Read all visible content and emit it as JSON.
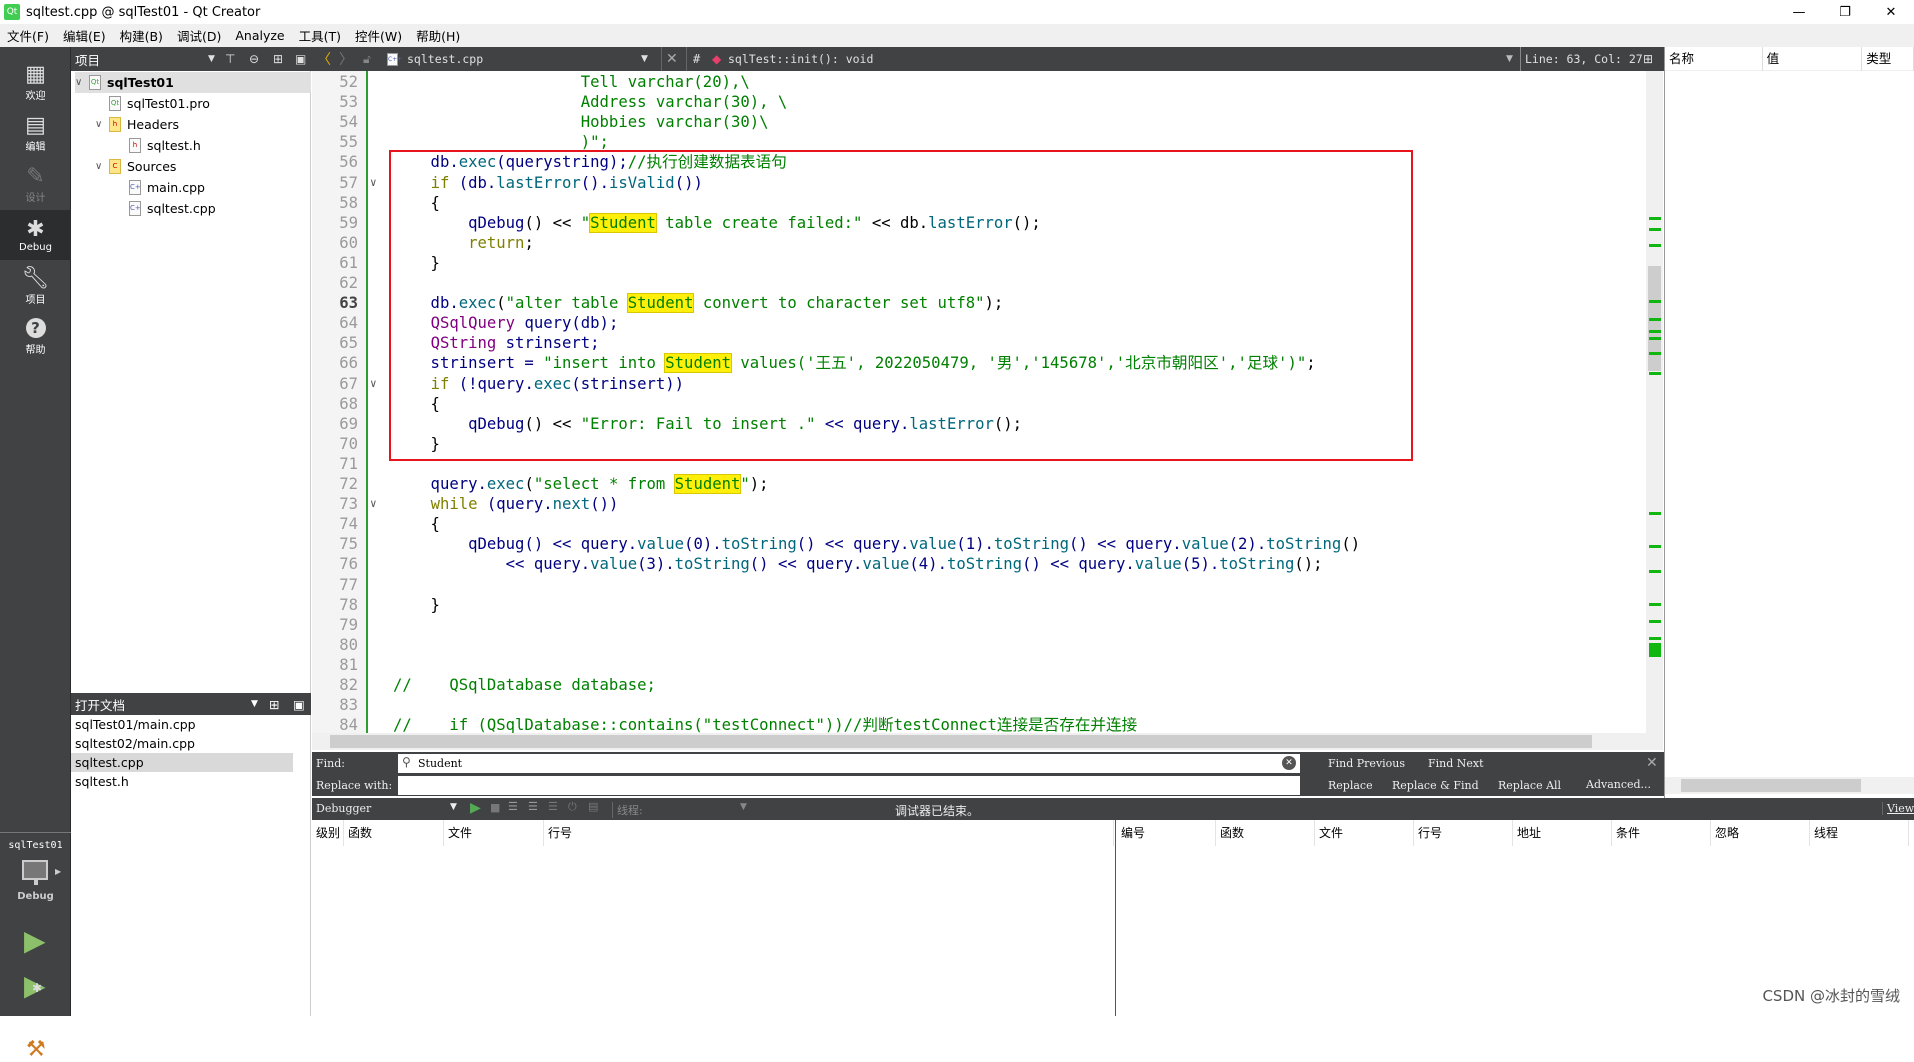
{
  "window": {
    "title": "sqltest.cpp @ sqlTest01 - Qt Creator",
    "app_icon": "Qt",
    "controls": [
      "—",
      "❐",
      "✕"
    ]
  },
  "menu": [
    "文件(F)",
    "编辑(E)",
    "构建(B)",
    "调试(D)",
    "Analyze",
    "工具(T)",
    "控件(W)",
    "帮助(H)"
  ],
  "modes": [
    {
      "label": "欢迎",
      "icon": "grid-icon",
      "state": "normal"
    },
    {
      "label": "编辑",
      "icon": "document-icon",
      "state": "normal"
    },
    {
      "label": "设计",
      "icon": "pen-icon",
      "state": "disabled"
    },
    {
      "label": "Debug",
      "icon": "bug-icon",
      "state": "active"
    },
    {
      "label": "项目",
      "icon": "wrench-icon",
      "state": "normal"
    },
    {
      "label": "帮助",
      "icon": "help-icon",
      "state": "normal"
    }
  ],
  "kit": {
    "project": "sqlTest01",
    "config": "Debug"
  },
  "project_panel": {
    "title": "项目",
    "tree": [
      {
        "label": "sqlTest01",
        "level": 0,
        "fold": "expanded",
        "icon": "qt-project-icon",
        "bold": true,
        "selected": true
      },
      {
        "label": "sqlTest01.pro",
        "level": 1,
        "icon": "pro-file-icon"
      },
      {
        "label": "Headers",
        "level": 1,
        "fold": "expanded",
        "icon": "headers-folder-icon"
      },
      {
        "label": "sqltest.h",
        "level": 2,
        "icon": "header-file-icon"
      },
      {
        "label": "Sources",
        "level": 1,
        "fold": "expanded",
        "icon": "sources-folder-icon"
      },
      {
        "label": "main.cpp",
        "level": 2,
        "icon": "cpp-file-icon"
      },
      {
        "label": "sqltest.cpp",
        "level": 2,
        "icon": "cpp-file-icon"
      }
    ]
  },
  "open_documents": {
    "title": "打开文档",
    "items": [
      "sqlTest01/main.cpp",
      "sqltest02/main.cpp",
      "sqltest.cpp",
      "sqltest.h"
    ],
    "selected": 2
  },
  "editor_toolbar": {
    "file": "sqltest.cpp",
    "hash": "#",
    "symbol": "sqlTest::init(): void",
    "position": "Line: 63, Col: 27"
  },
  "editor": {
    "current_line": 63,
    "lines": [
      {
        "n": 52,
        "tokens": [
          [
            "                    Tell varchar(20),\\",
            "s"
          ]
        ]
      },
      {
        "n": 53,
        "tokens": [
          [
            "                    Address varchar(30), \\",
            "s"
          ]
        ]
      },
      {
        "n": 54,
        "tokens": [
          [
            "                    Hobbies varchar(30)\\",
            "s"
          ]
        ]
      },
      {
        "n": 55,
        "tokens": [
          [
            "                    )\";",
            "s"
          ]
        ]
      },
      {
        "n": 56,
        "tokens": [
          [
            "    db.",
            "n"
          ],
          [
            "exec",
            "f"
          ],
          [
            "(querystring);",
            "n"
          ],
          [
            "//执行创建数据表语句",
            "c"
          ]
        ]
      },
      {
        "n": 57,
        "fold": true,
        "tokens": [
          [
            "    ",
            "n"
          ],
          [
            "if",
            "k"
          ],
          [
            " (db.",
            "n"
          ],
          [
            "lastError",
            "f"
          ],
          [
            "().",
            "n"
          ],
          [
            "isValid",
            "f"
          ],
          [
            "())",
            "n"
          ]
        ]
      },
      {
        "n": 58,
        "tokens": [
          [
            "    {",
            "p"
          ]
        ]
      },
      {
        "n": 59,
        "tokens": [
          [
            "        qDebug",
            "n"
          ],
          [
            "() << ",
            "p"
          ],
          [
            "\"",
            "s"
          ],
          [
            "Student",
            "h"
          ],
          [
            " table create failed:\"",
            "s"
          ],
          [
            " << db.",
            "p"
          ],
          [
            "lastError",
            "f"
          ],
          [
            "();",
            "p"
          ]
        ]
      },
      {
        "n": 60,
        "tokens": [
          [
            "        ",
            "n"
          ],
          [
            "return",
            "k"
          ],
          [
            ";",
            "p"
          ]
        ]
      },
      {
        "n": 61,
        "tokens": [
          [
            "    }",
            "p"
          ]
        ]
      },
      {
        "n": 62,
        "tokens": []
      },
      {
        "n": 63,
        "tokens": [
          [
            "    db.",
            "n"
          ],
          [
            "exec",
            "f"
          ],
          [
            "(",
            "p"
          ],
          [
            "\"alter table ",
            "s"
          ],
          [
            "Student",
            "h"
          ],
          [
            " convert to character set utf8\"",
            "s"
          ],
          [
            ");",
            "p"
          ]
        ]
      },
      {
        "n": 64,
        "tokens": [
          [
            "    ",
            "n"
          ],
          [
            "QSqlQuery",
            "t"
          ],
          [
            " query(db);",
            "n"
          ]
        ]
      },
      {
        "n": 65,
        "tokens": [
          [
            "    ",
            "n"
          ],
          [
            "QString",
            "t"
          ],
          [
            " strinsert;",
            "n"
          ]
        ]
      },
      {
        "n": 66,
        "tokens": [
          [
            "    strinsert = ",
            "n"
          ],
          [
            "\"insert into ",
            "s"
          ],
          [
            "Student",
            "h"
          ],
          [
            " values('王五', 2022050479, '男','145678','北京市朝阳区','足球')\"",
            "s"
          ],
          [
            ";",
            "p"
          ]
        ]
      },
      {
        "n": 67,
        "fold": true,
        "tokens": [
          [
            "    ",
            "n"
          ],
          [
            "if",
            "k"
          ],
          [
            " (!query.",
            "n"
          ],
          [
            "exec",
            "f"
          ],
          [
            "(strinsert))",
            "n"
          ]
        ]
      },
      {
        "n": 68,
        "tokens": [
          [
            "    {",
            "p"
          ]
        ]
      },
      {
        "n": 69,
        "tokens": [
          [
            "        qDebug",
            "n"
          ],
          [
            "() << ",
            "p"
          ],
          [
            "\"Error: Fail to insert .\"",
            "s"
          ],
          [
            " << query.",
            "n"
          ],
          [
            "lastError",
            "f"
          ],
          [
            "();",
            "p"
          ]
        ]
      },
      {
        "n": 70,
        "tokens": [
          [
            "    }",
            "p"
          ]
        ]
      },
      {
        "n": 71,
        "tokens": []
      },
      {
        "n": 72,
        "tokens": [
          [
            "    query.",
            "n"
          ],
          [
            "exec",
            "f"
          ],
          [
            "(",
            "p"
          ],
          [
            "\"select * from ",
            "s"
          ],
          [
            "Student",
            "h"
          ],
          [
            "\"",
            "s"
          ],
          [
            ");",
            "p"
          ]
        ]
      },
      {
        "n": 73,
        "fold": true,
        "tokens": [
          [
            "    ",
            "n"
          ],
          [
            "while",
            "k"
          ],
          [
            " (query.",
            "n"
          ],
          [
            "next",
            "f"
          ],
          [
            "())",
            "n"
          ]
        ]
      },
      {
        "n": 74,
        "tokens": [
          [
            "    {",
            "p"
          ]
        ]
      },
      {
        "n": 75,
        "tokens": [
          [
            "        qDebug",
            "n"
          ],
          [
            "() << query.",
            "n"
          ],
          [
            "value",
            "f"
          ],
          [
            "(0).",
            "n"
          ],
          [
            "toString",
            "f"
          ],
          [
            "() << query.",
            "n"
          ],
          [
            "value",
            "f"
          ],
          [
            "(1).",
            "n"
          ],
          [
            "toString",
            "f"
          ],
          [
            "() << query.",
            "n"
          ],
          [
            "value",
            "f"
          ],
          [
            "(2).",
            "n"
          ],
          [
            "toString",
            "f"
          ],
          [
            "()",
            "p"
          ]
        ]
      },
      {
        "n": 76,
        "tokens": [
          [
            "            << query.",
            "n"
          ],
          [
            "value",
            "f"
          ],
          [
            "(3).",
            "n"
          ],
          [
            "toString",
            "f"
          ],
          [
            "() << query.",
            "n"
          ],
          [
            "value",
            "f"
          ],
          [
            "(4).",
            "n"
          ],
          [
            "toString",
            "f"
          ],
          [
            "() << query.",
            "n"
          ],
          [
            "value",
            "f"
          ],
          [
            "(5).",
            "n"
          ],
          [
            "toString",
            "f"
          ],
          [
            "();",
            "p"
          ]
        ]
      },
      {
        "n": 77,
        "tokens": []
      },
      {
        "n": 78,
        "tokens": [
          [
            "    }",
            "p"
          ]
        ]
      },
      {
        "n": 79,
        "tokens": []
      },
      {
        "n": 80,
        "tokens": []
      },
      {
        "n": 81,
        "tokens": []
      },
      {
        "n": 82,
        "tokens": [
          [
            "//    QSqlDatabase database;",
            "c"
          ]
        ]
      },
      {
        "n": 83,
        "tokens": []
      },
      {
        "n": 84,
        "tokens": [
          [
            "//    if (QSqlDatabase::contains(\"testConnect\"))//判断testConnect连接是否存在并连接",
            "c"
          ]
        ]
      }
    ]
  },
  "find": {
    "find_label": "Find:",
    "find_value": "Student",
    "replace_label": "Replace with:",
    "replace_value": "",
    "buttons": [
      "Find Previous",
      "Find Next",
      "Replace",
      "Replace & Find",
      "Replace All",
      "Advanced..."
    ]
  },
  "locals_panel": {
    "columns": [
      "名称",
      "值",
      "类型"
    ]
  },
  "debugger": {
    "selector": "Debugger",
    "thread_label": "线程:",
    "status": "调试器已结束。",
    "views": "Views",
    "stack_columns": [
      "级别",
      "函数",
      "文件",
      "行号"
    ],
    "breakpoint_columns": [
      "编号",
      "函数",
      "文件",
      "行号",
      "地址",
      "条件",
      "忽略",
      "线程"
    ]
  },
  "watermark": "CSDN @冰封的雪绒",
  "colors": {
    "highlight": "#ffef0b",
    "annotation_box": "#e8141d",
    "sidebar": "#404244",
    "string": "#008000",
    "keyword": "#808000",
    "type": "#800080"
  }
}
